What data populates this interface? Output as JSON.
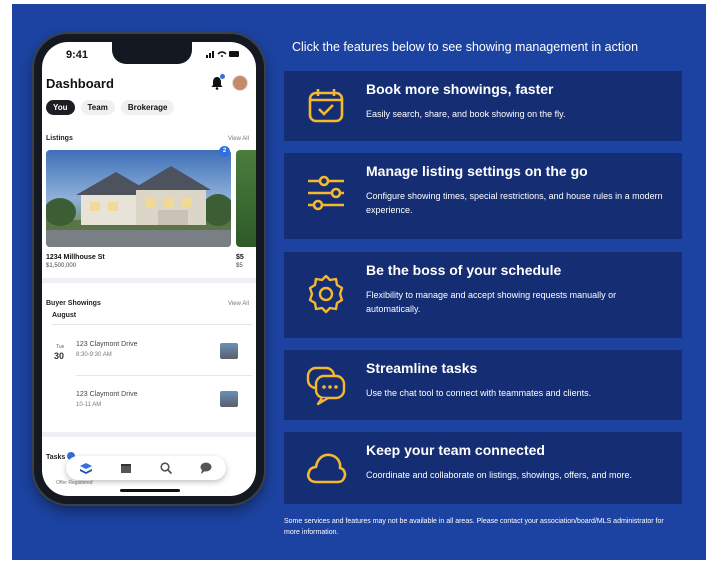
{
  "phone": {
    "status_time": "9:41",
    "title": "Dashboard",
    "tabs": [
      "You",
      "Team",
      "Brokerage"
    ],
    "listings_label": "Listings",
    "view_all": "View All",
    "listing_badge": "2",
    "listing_address": "1234 Millhouse St",
    "listing_price": "$1,500,000",
    "listing2_address": "$5",
    "listing2_price": "$5",
    "buyer_showings_label": "Buyer Showings",
    "month": "August",
    "showings": [
      {
        "day": "Tue",
        "date": "30",
        "address": "123 Claymont Drive",
        "time": "8:30-9:30 AM"
      },
      {
        "day": "",
        "date": "",
        "address": "123 Claymont Drive",
        "time": "10-11 AM"
      }
    ],
    "tasks_label": "Tasks",
    "offer_label": "Offer Registered"
  },
  "header": "Click the features below to see showing management in action",
  "features": [
    {
      "icon": "calendar-check-icon",
      "title": "Book more showings, faster",
      "desc": "Easily search, share, and book showing on the fly."
    },
    {
      "icon": "sliders-icon",
      "title": "Manage listing settings on the go",
      "desc": "Configure showing times, special restrictions, and house rules in a modern experience."
    },
    {
      "icon": "gear-icon",
      "title": "Be the boss of your schedule",
      "desc": "Flexibility to manage and accept showing requests manually or automatically."
    },
    {
      "icon": "chat-bubbles-icon",
      "title": "Streamline tasks",
      "desc": "Use the chat tool to connect with teammates and clients."
    },
    {
      "icon": "cloud-icon",
      "title": "Keep your team connected",
      "desc": "Coordinate and collaborate on listings, showings, offers, and more."
    }
  ],
  "footer": "Some services and features may not be available in all areas. Please contact your association/board/MLS administrator for more information.",
  "colors": {
    "panel": "#1c43a1",
    "card": "#152e73",
    "icon": "#f5b82e"
  }
}
